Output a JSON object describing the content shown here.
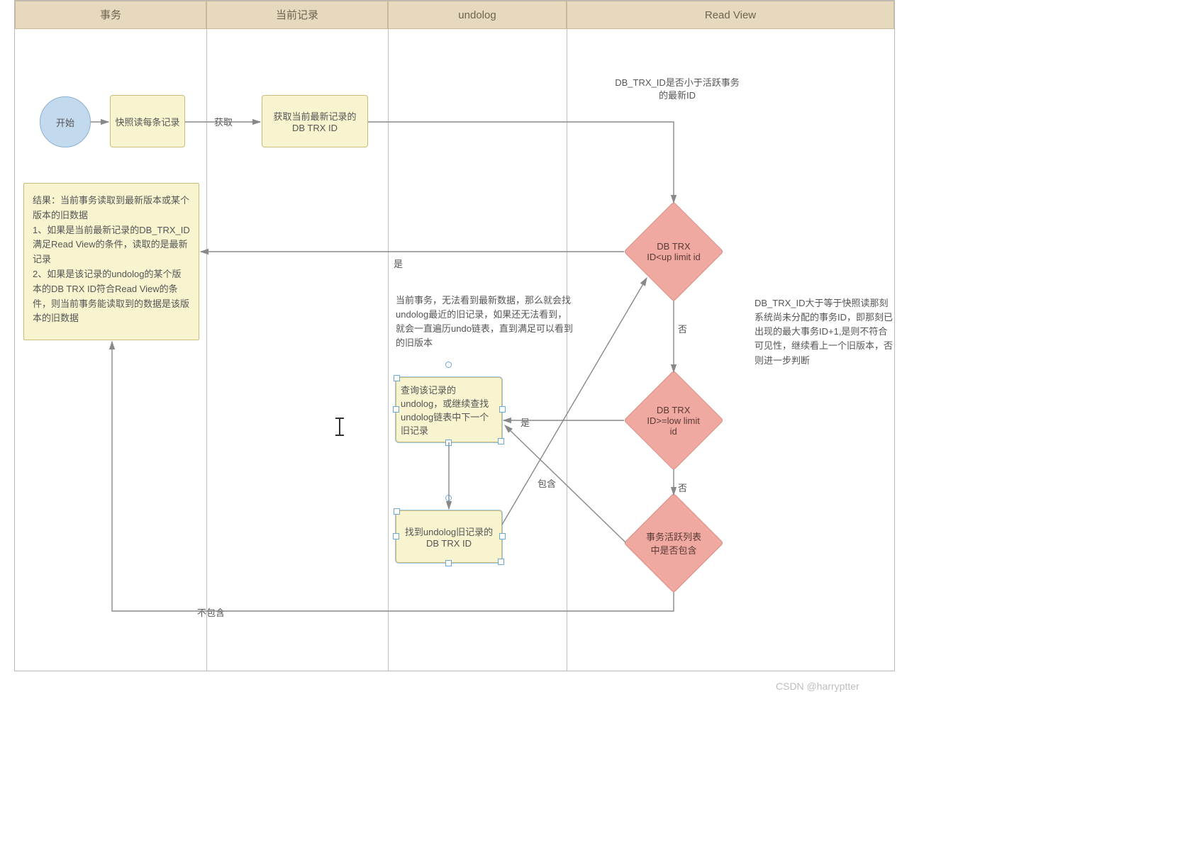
{
  "lanes": {
    "l0": "事务",
    "l1": "当前记录",
    "l2": "undolog",
    "l3": "Read View"
  },
  "nodes": {
    "start": "开始",
    "snapshot": "快照读每条记录",
    "getTrx": "获取当前最新记录的 DB TRX ID",
    "result": "结果：当前事务读取到最新版本或某个版本的旧数据\n1、如果是当前最新记录的DB_TRX_ID满足Read View的条件，读取的是最新记录\n2、如果是该记录的undolog的某个版本的DB TRX ID符合Read View的条件，则当前事务能读取到的数据是该版本的旧数据",
    "undologNote": "当前事务，无法看到最新数据，那么就会找undolog最近的旧记录，如果还无法看到，就会一直遍历undo链表，直到满足可以看到的旧版本",
    "queryUndo": "查询该记录的undolog，或继续查找undolog链表中下一个旧记录",
    "foundUndo": "找到undolog旧记录的DB TRX ID",
    "dec1": "DB TRX ID<up limit id",
    "dec2": "DB TRX ID>=low limit id",
    "dec3": "事务活跃列表中是否包含"
  },
  "labels": {
    "acquire": "获取",
    "topNote": "DB_TRX_ID是否小于活跃事务的最新ID",
    "yes": "是",
    "no1": "否",
    "no2": "否",
    "contain": "包含",
    "notContain": "不包含",
    "sideNote": "DB_TRX_ID大于等于快照读那刻系统尚未分配的事务ID，即那刻已出现的最大事务ID+1,是则不符合可见性，继续看上一个旧版本，否则进一步判断"
  },
  "watermark": "CSDN @harryptter"
}
